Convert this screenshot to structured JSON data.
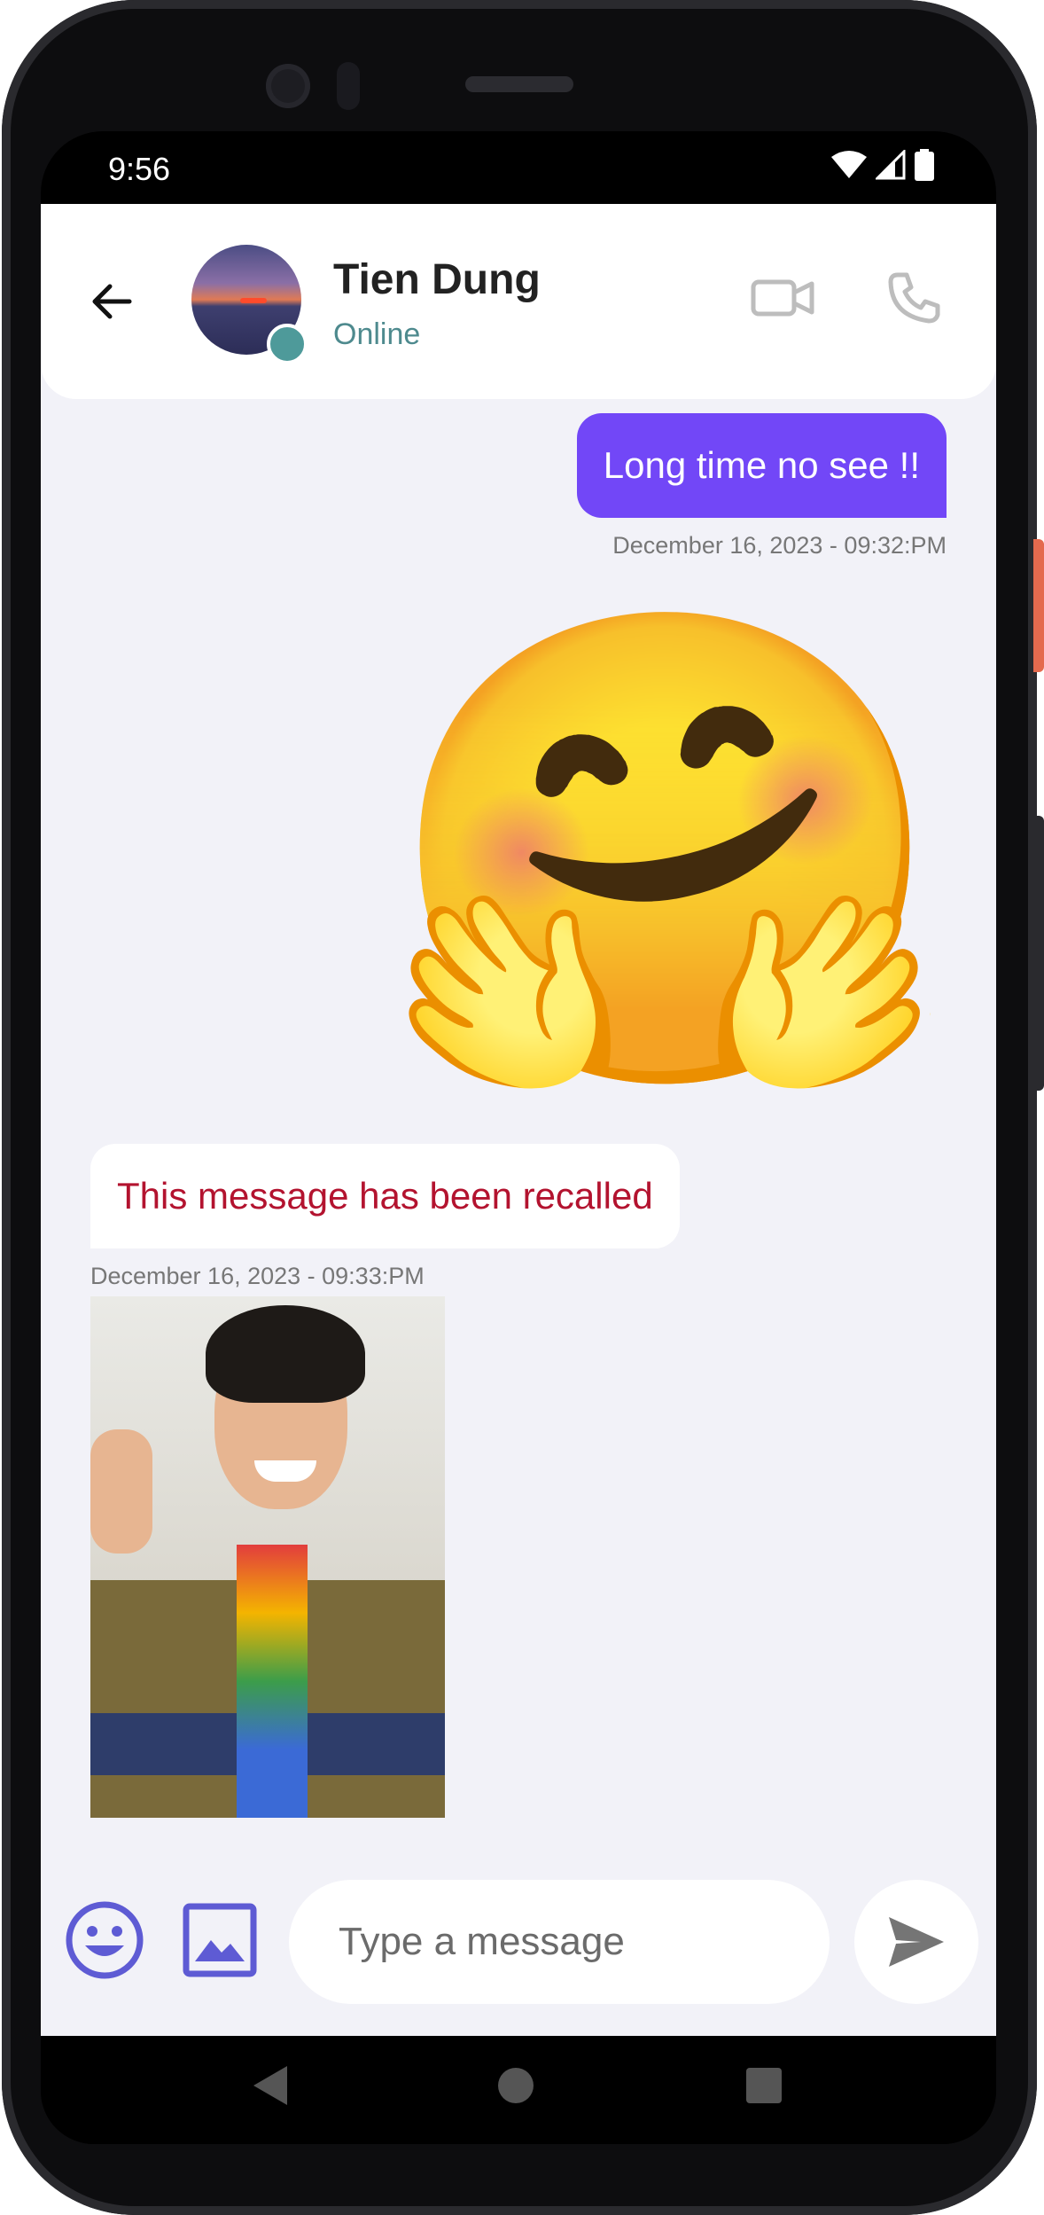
{
  "status_bar": {
    "time": "9:56"
  },
  "header": {
    "contact_name": "Tien Dung",
    "contact_status": "Online"
  },
  "messages": [
    {
      "direction": "outgoing",
      "type": "text",
      "text": "Long time no see !!",
      "timestamp": "December 16, 2023 - 09:32:PM"
    },
    {
      "direction": "outgoing",
      "type": "emoji",
      "emoji": "🤗"
    },
    {
      "direction": "incoming",
      "type": "recalled",
      "text": "This message has been recalled",
      "timestamp": "December 16, 2023 - 09:33:PM"
    },
    {
      "direction": "incoming",
      "type": "image"
    }
  ],
  "composer": {
    "placeholder": "Type a message"
  },
  "colors": {
    "accent": "#7247f7",
    "recalled_text": "#b3132f",
    "online": "#4e9a9a",
    "icon_accent": "#5e5bd4",
    "background": "#f2f2f8"
  }
}
